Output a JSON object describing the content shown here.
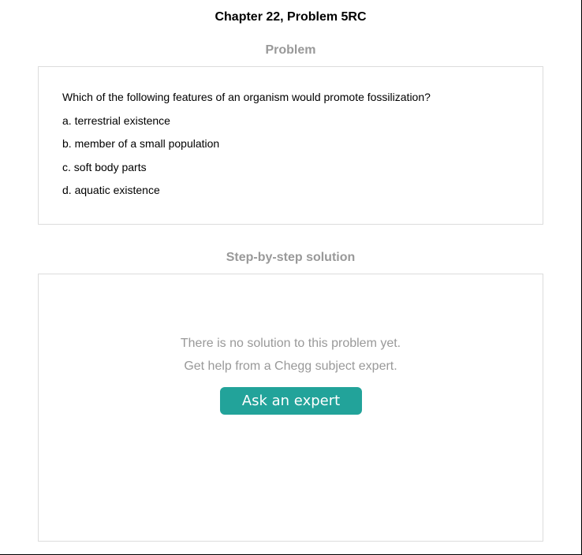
{
  "page_title": "Chapter 22, Problem 5RC",
  "problem_section": {
    "heading": "Problem",
    "question": "Which of the following features of an organism would promote fossilization?",
    "options": [
      "a. terrestrial existence",
      "b. member of a small population",
      "c. soft body parts",
      "d. aquatic existence"
    ]
  },
  "solution_section": {
    "heading": "Step-by-step solution",
    "message_line1": "There is no solution to this problem yet.",
    "message_line2": "Get help from a Chegg subject expert.",
    "button_label": "Ask an expert",
    "button_color": "#22a39a"
  }
}
